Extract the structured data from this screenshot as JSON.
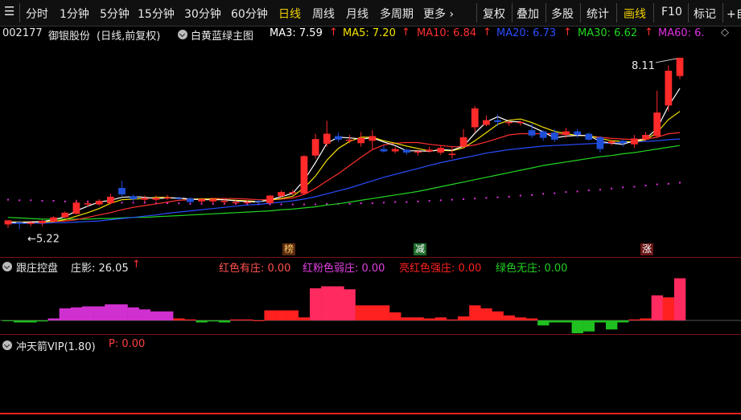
{
  "toolbar": {
    "period_tabs": [
      "分时",
      "1分钟",
      "5分钟",
      "15分钟",
      "30分钟",
      "60分钟",
      "日线",
      "周线",
      "月线",
      "多周期",
      "更多 ›"
    ],
    "active_tab": "日线",
    "tools": [
      "复权",
      "叠加",
      "多股",
      "统计",
      "画线",
      "F10",
      "标记",
      "+自"
    ],
    "active_tool": "画线"
  },
  "main_panel": {
    "stock_code": "002177",
    "stock_name": "御银股份",
    "period_desc": "(日线,前复权)",
    "indicator_name": "白黄蓝绿主图",
    "ma": [
      {
        "label": "MA3: 7.59",
        "color": "#ffffff"
      },
      {
        "label": "MA5: 7.20",
        "color": "#f5e400"
      },
      {
        "label": "MA10: 6.84",
        "color": "#ff3030"
      },
      {
        "label": "MA20: 6.73",
        "color": "#2a4dff"
      },
      {
        "label": "MA30: 6.62",
        "color": "#22d622"
      },
      {
        "label": "MA60: 6.",
        "color": "#e030e0"
      }
    ],
    "high_label": "8.11",
    "low_label": "5.22",
    "markers": [
      {
        "text": "榜",
        "color": "#ffcc66",
        "bg": "#5a2a10"
      },
      {
        "text": "减",
        "color": "#ffffff",
        "bg": "#1e6a2a"
      },
      {
        "text": "涨",
        "color": "#ffffff",
        "bg": "#6a1515"
      }
    ]
  },
  "panel2": {
    "title": "跟庄控盘",
    "shadow_label": "庄影: 26.05",
    "legend": [
      {
        "text": "红色有庄: 0.00",
        "color": "#ff5050"
      },
      {
        "text": "红粉色弱庄: 0.00",
        "color": "#e040e0"
      },
      {
        "text": "亮红色强庄: 0.00",
        "color": "#ff2020"
      },
      {
        "text": "绿色无庄: 0.00",
        "color": "#20d020"
      }
    ]
  },
  "panel3": {
    "title": "冲天箭VIP(1.80)",
    "p_label": "P: 0.00"
  },
  "colors": {
    "up": "#ff2a2a",
    "down": "#1e4fd8",
    "bg": "#000000"
  },
  "chart_data": {
    "type": "candlestick",
    "title": "",
    "ylim": [
      5.0,
      8.3
    ],
    "candles": [
      [
        5.28,
        5.35,
        5.22,
        5.34
      ],
      [
        5.32,
        5.3,
        5.2,
        5.35
      ],
      [
        5.3,
        5.31,
        5.25,
        5.34
      ],
      [
        5.3,
        5.34,
        5.25,
        5.36
      ],
      [
        5.33,
        5.4,
        5.31,
        5.42
      ],
      [
        5.4,
        5.48,
        5.38,
        5.5
      ],
      [
        5.46,
        5.65,
        5.45,
        5.7
      ],
      [
        5.62,
        5.64,
        5.58,
        5.67
      ],
      [
        5.62,
        5.68,
        5.6,
        5.71
      ],
      [
        5.64,
        5.75,
        5.62,
        5.8
      ],
      [
        5.9,
        5.79,
        5.76,
        6.02
      ],
      [
        5.76,
        5.71,
        5.68,
        5.79
      ],
      [
        5.7,
        5.73,
        5.66,
        5.77
      ],
      [
        5.7,
        5.73,
        5.67,
        5.77
      ],
      [
        5.72,
        5.74,
        5.7,
        5.78
      ],
      [
        5.73,
        5.72,
        5.7,
        5.75
      ],
      [
        5.72,
        5.66,
        5.64,
        5.74
      ],
      [
        5.67,
        5.71,
        5.64,
        5.73
      ],
      [
        5.67,
        5.71,
        5.64,
        5.73
      ],
      [
        5.66,
        5.68,
        5.62,
        5.72
      ],
      [
        5.66,
        5.66,
        5.63,
        5.69
      ],
      [
        5.66,
        5.66,
        5.63,
        5.69
      ],
      [
        5.68,
        5.66,
        5.64,
        5.7
      ],
      [
        5.64,
        5.77,
        5.62,
        5.78
      ],
      [
        5.76,
        5.83,
        5.74,
        5.86
      ],
      [
        5.82,
        5.83,
        5.78,
        5.87
      ],
      [
        5.8,
        6.44,
        5.78,
        6.46
      ],
      [
        6.45,
        6.73,
        6.4,
        6.82
      ],
      [
        6.65,
        6.82,
        6.6,
        7.04
      ],
      [
        6.78,
        6.72,
        6.68,
        6.84
      ],
      [
        6.7,
        6.72,
        6.66,
        6.8
      ],
      [
        6.66,
        6.75,
        6.6,
        6.85
      ],
      [
        6.7,
        6.78,
        6.55,
        6.88
      ],
      [
        6.56,
        6.52,
        6.5,
        6.62
      ],
      [
        6.52,
        6.56,
        6.49,
        6.6
      ],
      [
        6.55,
        6.5,
        6.46,
        6.57
      ],
      [
        6.5,
        6.52,
        6.45,
        6.55
      ],
      [
        6.52,
        6.55,
        6.5,
        6.6
      ],
      [
        6.5,
        6.58,
        6.46,
        6.62
      ],
      [
        6.48,
        6.48,
        6.4,
        6.6
      ],
      [
        6.6,
        6.76,
        6.57,
        6.9
      ],
      [
        6.93,
        7.25,
        6.85,
        7.29
      ],
      [
        6.97,
        7.05,
        6.95,
        7.13
      ],
      [
        7.05,
        7.02,
        6.95,
        7.15
      ],
      [
        7.0,
        7.02,
        6.95,
        7.04
      ],
      [
        7.0,
        7.02,
        6.96,
        7.04
      ],
      [
        6.88,
        6.79,
        6.75,
        7.0
      ],
      [
        6.86,
        6.75,
        6.7,
        6.88
      ],
      [
        6.84,
        6.72,
        6.68,
        6.9
      ],
      [
        6.8,
        6.86,
        6.75,
        6.92
      ],
      [
        6.86,
        6.8,
        6.75,
        6.9
      ],
      [
        6.82,
        6.72,
        6.7,
        6.84
      ],
      [
        6.76,
        6.56,
        6.5,
        6.78
      ],
      [
        6.66,
        6.69,
        6.62,
        6.72
      ],
      [
        6.7,
        6.66,
        6.6,
        6.72
      ],
      [
        6.64,
        6.74,
        6.58,
        6.8
      ],
      [
        6.72,
        6.8,
        6.7,
        6.85
      ],
      [
        6.78,
        7.18,
        6.75,
        7.55
      ],
      [
        7.3,
        7.89,
        7.2,
        7.98
      ],
      [
        7.8,
        8.11,
        7.75,
        8.11
      ]
    ],
    "series": [
      {
        "name": "MA3",
        "color": "#ffffff",
        "values": [
          5.32,
          5.31,
          5.32,
          5.33,
          5.36,
          5.41,
          5.51,
          5.59,
          5.66,
          5.69,
          5.74,
          5.75,
          5.74,
          5.72,
          5.73,
          5.73,
          5.71,
          5.7,
          5.7,
          5.7,
          5.68,
          5.67,
          5.66,
          5.7,
          5.75,
          5.81,
          6.03,
          6.33,
          6.66,
          6.76,
          6.75,
          6.73,
          6.75,
          6.68,
          6.62,
          6.53,
          6.53,
          6.52,
          6.55,
          6.54,
          6.61,
          6.83,
          7.02,
          7.11,
          7.03,
          7.02,
          6.94,
          6.85,
          6.75,
          6.78,
          6.79,
          6.79,
          6.69,
          6.66,
          6.64,
          6.7,
          6.73,
          6.91,
          7.29,
          7.59
        ]
      },
      {
        "name": "MA5",
        "color": "#f5e400",
        "values": [
          5.32,
          5.32,
          5.32,
          5.32,
          5.33,
          5.36,
          5.42,
          5.48,
          5.55,
          5.64,
          5.7,
          5.71,
          5.72,
          5.74,
          5.74,
          5.72,
          5.71,
          5.71,
          5.71,
          5.7,
          5.69,
          5.68,
          5.67,
          5.69,
          5.72,
          5.76,
          5.9,
          6.1,
          6.37,
          6.57,
          6.69,
          6.76,
          6.76,
          6.7,
          6.66,
          6.61,
          6.57,
          6.53,
          6.54,
          6.53,
          6.58,
          6.7,
          6.84,
          6.98,
          7.05,
          7.07,
          7.01,
          6.93,
          6.86,
          6.82,
          6.79,
          6.79,
          6.74,
          6.7,
          6.69,
          6.68,
          6.72,
          6.84,
          7.06,
          7.2
        ]
      },
      {
        "name": "MA10",
        "color": "#ff3030",
        "values": [
          5.32,
          5.32,
          5.32,
          5.33,
          5.33,
          5.34,
          5.36,
          5.4,
          5.44,
          5.48,
          5.53,
          5.57,
          5.6,
          5.63,
          5.66,
          5.69,
          5.7,
          5.71,
          5.72,
          5.72,
          5.72,
          5.71,
          5.7,
          5.7,
          5.71,
          5.73,
          5.79,
          5.89,
          6.02,
          6.14,
          6.28,
          6.42,
          6.55,
          6.63,
          6.66,
          6.67,
          6.67,
          6.64,
          6.62,
          6.6,
          6.6,
          6.63,
          6.68,
          6.74,
          6.8,
          6.82,
          6.82,
          6.82,
          6.82,
          6.81,
          6.8,
          6.78,
          6.76,
          6.74,
          6.73,
          6.72,
          6.73,
          6.76,
          6.82,
          6.84
        ]
      },
      {
        "name": "MA20",
        "color": "#2a4dff",
        "values": [
          5.3,
          5.3,
          5.3,
          5.3,
          5.31,
          5.31,
          5.32,
          5.33,
          5.34,
          5.36,
          5.38,
          5.4,
          5.42,
          5.44,
          5.47,
          5.49,
          5.51,
          5.53,
          5.55,
          5.57,
          5.59,
          5.61,
          5.62,
          5.64,
          5.66,
          5.68,
          5.71,
          5.75,
          5.8,
          5.85,
          5.9,
          5.96,
          6.02,
          6.08,
          6.13,
          6.18,
          6.23,
          6.28,
          6.33,
          6.37,
          6.41,
          6.45,
          6.49,
          6.52,
          6.55,
          6.57,
          6.59,
          6.61,
          6.62,
          6.63,
          6.64,
          6.65,
          6.66,
          6.66,
          6.67,
          6.68,
          6.69,
          6.7,
          6.72,
          6.73
        ]
      },
      {
        "name": "MA30",
        "color": "#22d622",
        "values": [
          5.4,
          5.39,
          5.38,
          5.37,
          5.37,
          5.37,
          5.37,
          5.37,
          5.38,
          5.38,
          5.39,
          5.4,
          5.4,
          5.41,
          5.42,
          5.43,
          5.44,
          5.45,
          5.46,
          5.47,
          5.48,
          5.49,
          5.5,
          5.51,
          5.53,
          5.54,
          5.56,
          5.58,
          5.61,
          5.63,
          5.66,
          5.69,
          5.72,
          5.75,
          5.78,
          5.81,
          5.84,
          5.88,
          5.92,
          5.96,
          6.0,
          6.04,
          6.08,
          6.12,
          6.16,
          6.2,
          6.24,
          6.28,
          6.31,
          6.34,
          6.37,
          6.4,
          6.43,
          6.45,
          6.48,
          6.5,
          6.53,
          6.56,
          6.59,
          6.62
        ]
      },
      {
        "name": "MA60",
        "color": "#e030e0",
        "values": [
          5.7,
          5.69,
          5.69,
          5.68,
          5.68,
          5.67,
          5.67,
          5.67,
          5.66,
          5.66,
          5.65,
          5.65,
          5.65,
          5.64,
          5.64,
          5.64,
          5.63,
          5.63,
          5.63,
          5.63,
          5.63,
          5.62,
          5.62,
          5.62,
          5.62,
          5.62,
          5.62,
          5.62,
          5.63,
          5.63,
          5.63,
          5.64,
          5.64,
          5.65,
          5.66,
          5.66,
          5.67,
          5.68,
          5.69,
          5.7,
          5.71,
          5.72,
          5.73,
          5.74,
          5.75,
          5.77,
          5.78,
          5.8,
          5.81,
          5.83,
          5.84,
          5.86,
          5.87,
          5.89,
          5.91,
          5.92,
          5.94,
          5.96,
          5.97,
          5.99
        ]
      }
    ],
    "control_bars": [
      -0.05,
      -0.2,
      -0.2,
      -0.1,
      0.2,
      1.2,
      1.3,
      1.4,
      1.4,
      1.6,
      1.6,
      1.3,
      1.1,
      0.9,
      0.9,
      0.2,
      0.1,
      -0.2,
      -0.1,
      -0.2,
      0.1,
      0.1,
      0.0,
      1.0,
      1.0,
      1.0,
      0.3,
      3.2,
      3.4,
      3.4,
      3.1,
      1.5,
      1.5,
      1.5,
      0.8,
      0.3,
      0.3,
      0.2,
      0.3,
      0.1,
      0.4,
      1.5,
      1.2,
      0.9,
      0.5,
      0.3,
      0.2,
      -0.5,
      -0.2,
      -0.2,
      -1.7,
      -1.1,
      -0.2,
      -0.9,
      -0.2,
      0.1,
      0.2,
      2.5,
      2.3,
      4.2
    ],
    "arrow_signal": [
      0,
      0,
      0,
      0,
      0,
      0,
      0,
      0,
      0,
      0,
      0,
      0,
      0,
      0,
      0,
      0,
      0,
      0,
      0,
      0,
      0,
      0,
      0,
      0,
      0,
      0,
      0,
      0,
      0,
      0,
      0,
      0,
      0,
      0,
      0,
      0,
      0,
      0,
      0,
      0,
      0,
      0,
      0,
      0,
      0,
      0,
      0,
      0,
      0,
      0,
      0,
      0,
      0,
      0,
      0,
      0,
      0,
      0,
      0,
      0
    ]
  }
}
